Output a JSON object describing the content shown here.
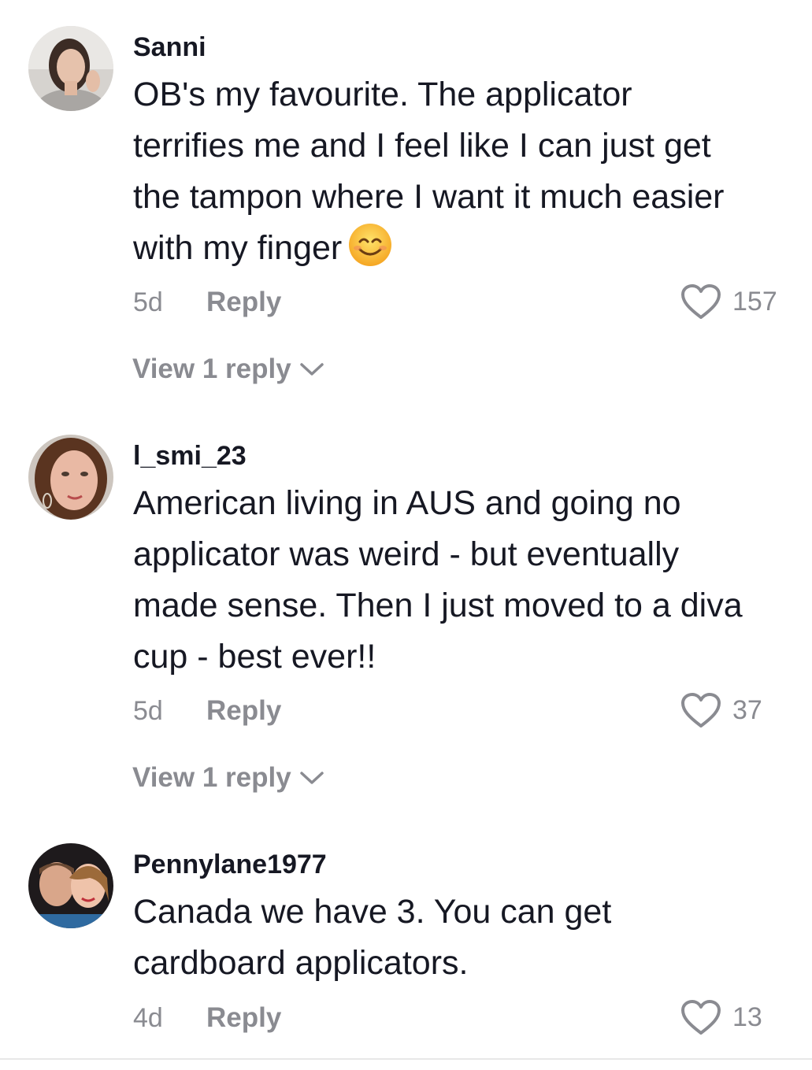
{
  "comments": [
    {
      "username": "Sanni",
      "text_lines": [
        "OB's my favourite. The applicator",
        "terrifies me and I feel like I can just get",
        "the tampon where I want it much easier",
        "with my finger"
      ],
      "emoji": "smiling-face-emoji",
      "age": "5d",
      "reply_label": "Reply",
      "likes": "157",
      "view_replies_label": "View 1 reply"
    },
    {
      "username": "l_smi_23",
      "text_lines": [
        "American living in AUS and going no",
        "applicator was weird - but eventually",
        "made sense. Then I just moved to a diva",
        "cup - best ever!!"
      ],
      "age": "5d",
      "reply_label": "Reply",
      "likes": "37",
      "view_replies_label": "View 1 reply"
    },
    {
      "username": "Pennylane1977",
      "text_lines": [
        "Canada we have 3. You can get",
        "cardboard applicators."
      ],
      "age": "4d",
      "reply_label": "Reply",
      "likes": "13"
    }
  ],
  "colors": {
    "primary_text": "#161823",
    "secondary_text": "#8a8b91",
    "background": "#ffffff"
  },
  "icons": {
    "like": "heart-outline-icon",
    "expand": "chevron-down-icon"
  }
}
